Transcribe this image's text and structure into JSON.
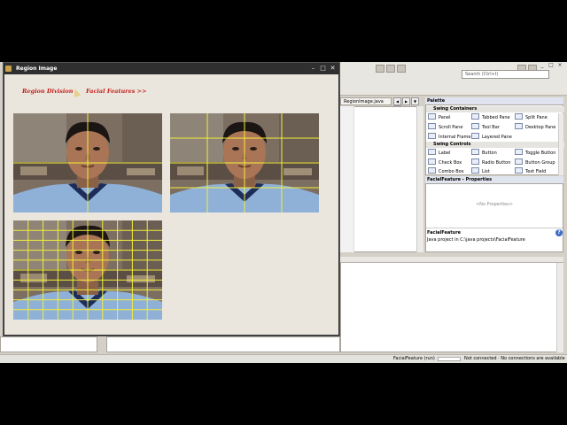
{
  "ide": {
    "search_placeholder": "Search (Ctrl+I)",
    "editor_tab": "RegionImage.java",
    "palette": {
      "title": "Palette",
      "sections": [
        {
          "label": "Swing Containers"
        },
        {
          "label": "Swing Controls"
        }
      ],
      "containers": [
        "Panel",
        "Tabbed Pane",
        "Split Pane",
        "Scroll Pane",
        "Tool Bar",
        "Desktop Pane",
        "Internal Frame",
        "Layered Pane"
      ],
      "controls": [
        "Label",
        "Button",
        "Toggle Button",
        "Check Box",
        "Radio Button",
        "Button Group",
        "Combo Box",
        "List",
        "Text Field"
      ]
    },
    "properties": {
      "title": "FacialFeature - Properties",
      "empty": "<No Properties>",
      "project_name": "FacialFeature",
      "project_desc": "Java project in C:\\java projects\\FacialFeature"
    },
    "status": {
      "project": "FacialFeature (run)",
      "connection": "Not connected · No connections are available"
    }
  },
  "region_window": {
    "title": "Region Image",
    "nav_region": "Region Division",
    "nav_facial": "Facial Features >>"
  },
  "colors": {
    "grid": "#f2ee3a",
    "nav_text": "#c2211e",
    "window_title_bg": "#2f2f2f",
    "window_body_bg": "#ebe6dd"
  }
}
